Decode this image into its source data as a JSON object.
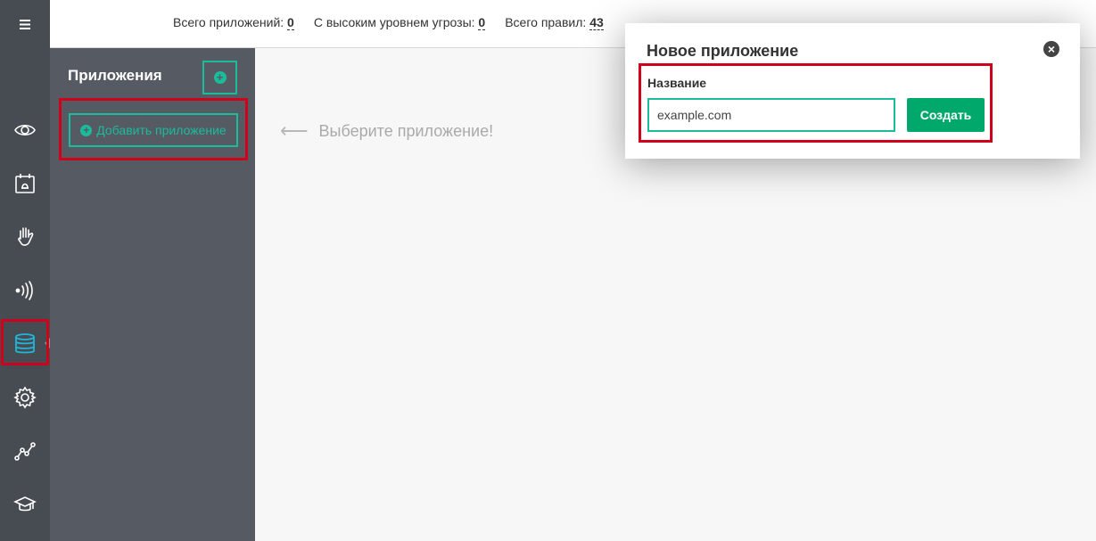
{
  "header": {
    "stats": [
      {
        "label": "Всего приложений:",
        "value": "0"
      },
      {
        "label": "С высоким уровнем угрозы:",
        "value": "0"
      },
      {
        "label": "Всего правил:",
        "value": "43"
      }
    ]
  },
  "nav": {
    "items": [
      {
        "name": "eye-icon"
      },
      {
        "name": "calendar-bell-icon"
      },
      {
        "name": "hand-icon"
      },
      {
        "name": "signal-waves-icon"
      },
      {
        "name": "database-icon",
        "active": true
      },
      {
        "name": "gear-icon"
      },
      {
        "name": "analytics-line-icon"
      },
      {
        "name": "graduation-cap-icon"
      }
    ]
  },
  "sidebar": {
    "title": "Приложения",
    "add_button_label": "Добавить приложение"
  },
  "main": {
    "hint": "Выберите приложение!"
  },
  "modal": {
    "title": "Новое приложение",
    "field_label": "Название",
    "input_value": "example.com",
    "create_label": "Создать"
  },
  "colors": {
    "accent": "#1abc9c",
    "primary_button": "#00a86b",
    "highlight": "#d0021b",
    "rail": "#474c53",
    "panel": "#555a63"
  }
}
